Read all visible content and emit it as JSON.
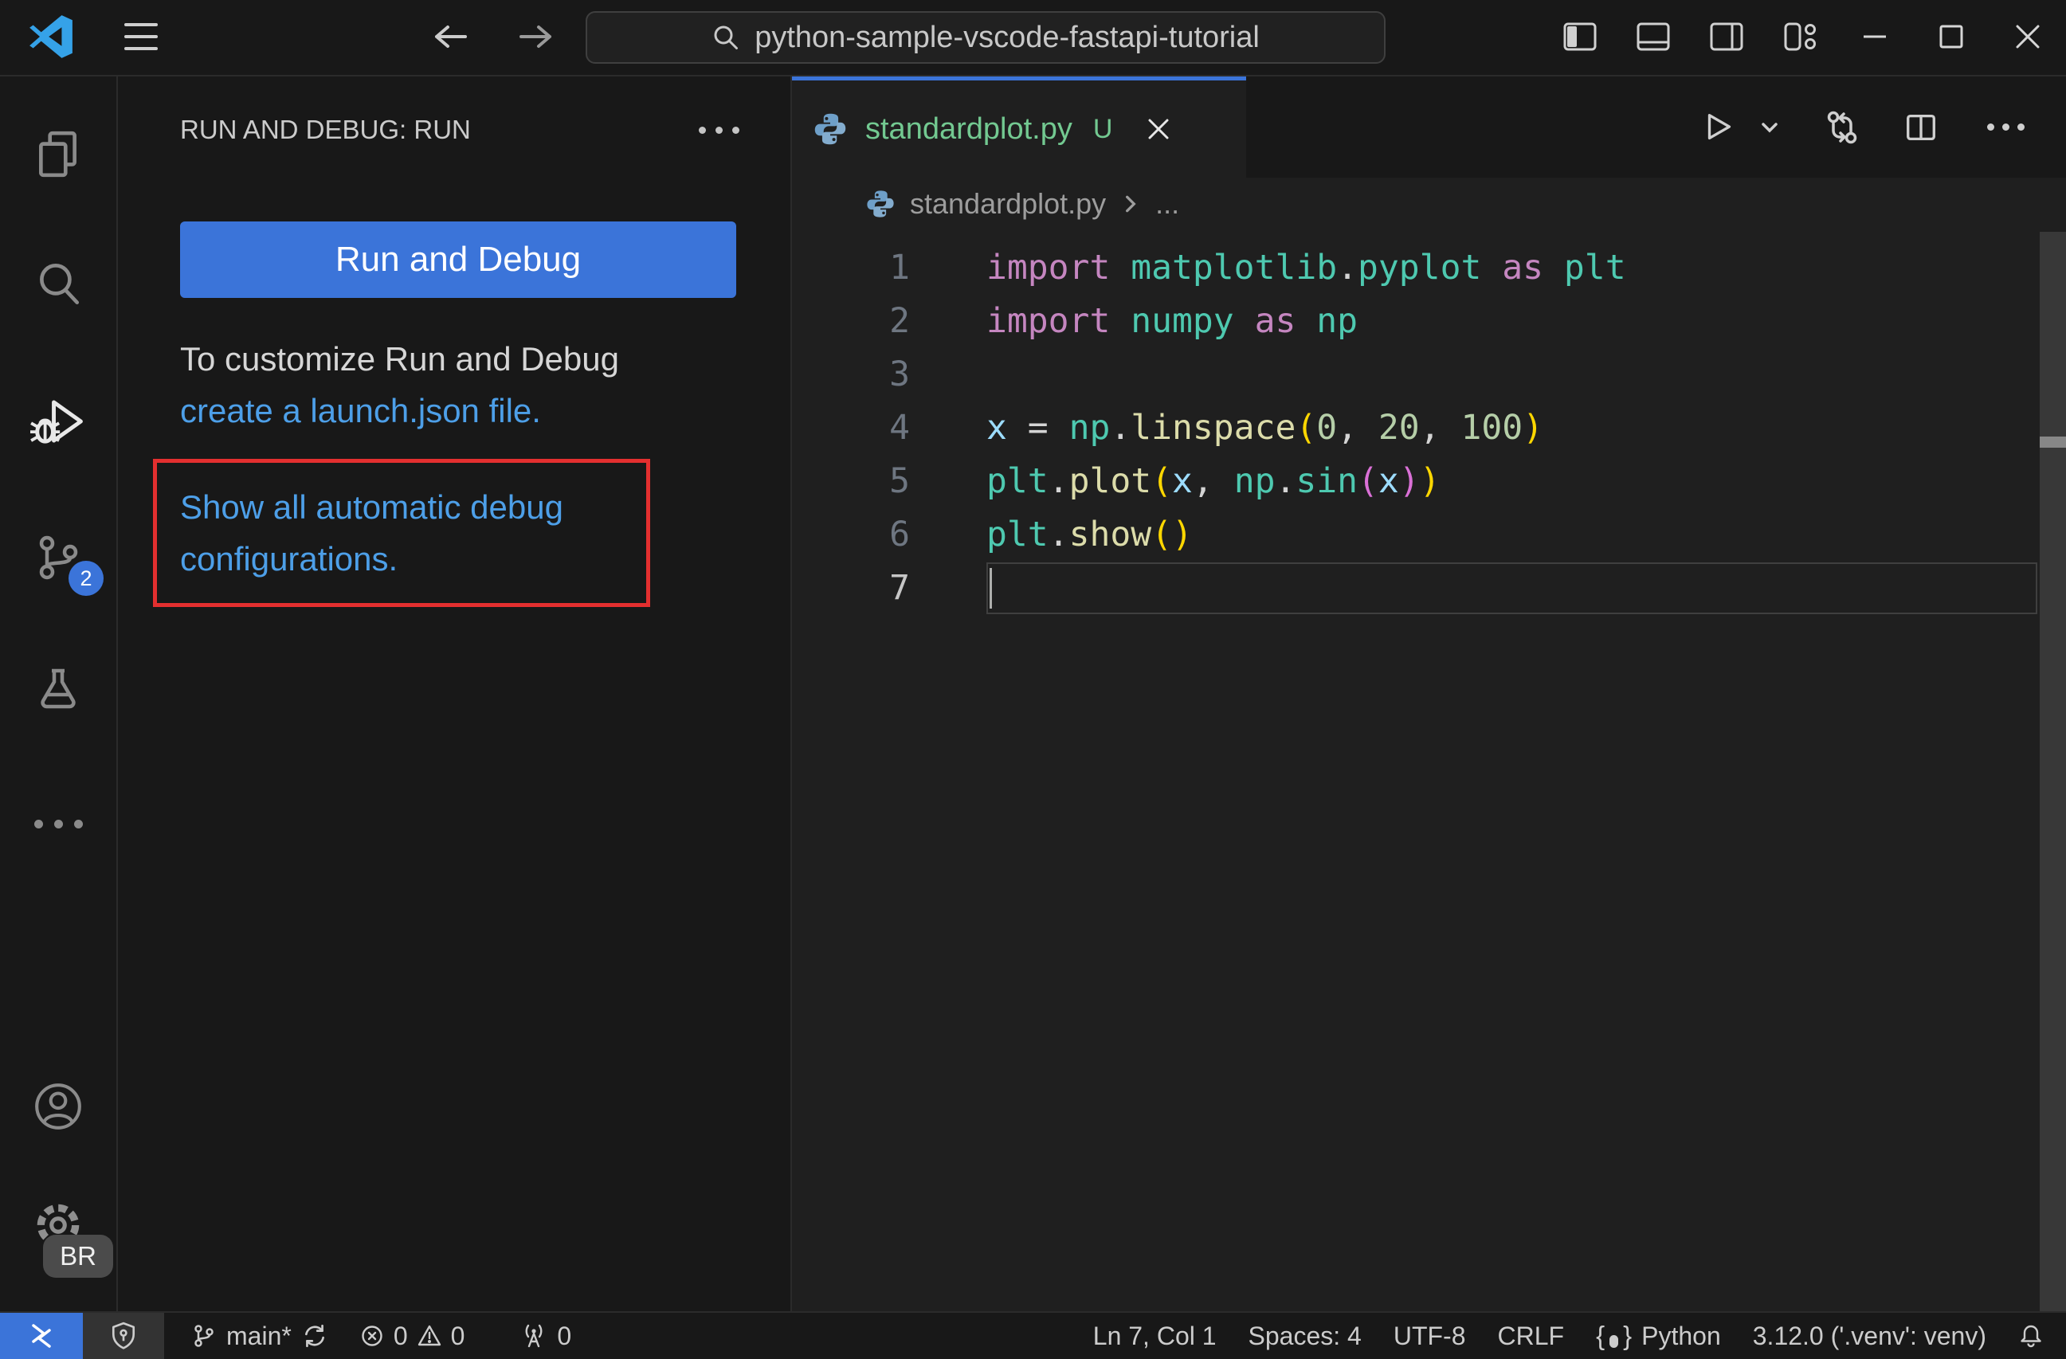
{
  "colors": {
    "accent_blue": "#3B74D9",
    "link_blue": "#4D9FE8",
    "annotation_red": "#E32F2F",
    "git_untracked_green": "#73C991",
    "editor_background": "#1F1F1F",
    "chrome_background": "#181818"
  },
  "title_bar": {
    "search_value": "python-sample-vscode-fastapi-tutorial"
  },
  "activity_bar": {
    "source_control_badge": "2",
    "settings_badge": "BR"
  },
  "sidebar": {
    "header": "RUN AND DEBUG: RUN",
    "run_button_label": "Run and Debug",
    "welcome_line1": "To customize Run and Debug",
    "welcome_link": "create a launch.json file.",
    "show_all_link_line1": "Show all automatic debug",
    "show_all_link_line2": "configurations."
  },
  "editor": {
    "tab": {
      "label": "standardplot.py",
      "modified_badge": "U"
    },
    "breadcrumb": {
      "file": "standardplot.py",
      "ellipsis": "..."
    },
    "code": {
      "lines": [
        {
          "num": "1",
          "current": false,
          "tokens": [
            {
              "t": "import",
              "c": "kw"
            },
            {
              "t": " ",
              "c": "pn"
            },
            {
              "t": "matplotlib",
              "c": "ns"
            },
            {
              "t": ".",
              "c": "pn"
            },
            {
              "t": "pyplot",
              "c": "ns"
            },
            {
              "t": " ",
              "c": "pn"
            },
            {
              "t": "as",
              "c": "kw"
            },
            {
              "t": " ",
              "c": "pn"
            },
            {
              "t": "plt",
              "c": "ns"
            }
          ]
        },
        {
          "num": "2",
          "current": false,
          "tokens": [
            {
              "t": "import",
              "c": "kw"
            },
            {
              "t": " ",
              "c": "pn"
            },
            {
              "t": "numpy",
              "c": "ns"
            },
            {
              "t": " ",
              "c": "pn"
            },
            {
              "t": "as",
              "c": "kw"
            },
            {
              "t": " ",
              "c": "pn"
            },
            {
              "t": "np",
              "c": "ns"
            }
          ]
        },
        {
          "num": "3",
          "current": false,
          "tokens": []
        },
        {
          "num": "4",
          "current": false,
          "tokens": [
            {
              "t": "x",
              "c": "var"
            },
            {
              "t": " ",
              "c": "pn"
            },
            {
              "t": "=",
              "c": "pn"
            },
            {
              "t": " ",
              "c": "pn"
            },
            {
              "t": "np",
              "c": "ns"
            },
            {
              "t": ".",
              "c": "pn"
            },
            {
              "t": "linspace",
              "c": "fn"
            },
            {
              "t": "(",
              "c": "b1"
            },
            {
              "t": "0",
              "c": "num"
            },
            {
              "t": ", ",
              "c": "pn"
            },
            {
              "t": "20",
              "c": "num"
            },
            {
              "t": ", ",
              "c": "pn"
            },
            {
              "t": "100",
              "c": "num"
            },
            {
              "t": ")",
              "c": "b1"
            }
          ]
        },
        {
          "num": "5",
          "current": false,
          "tokens": [
            {
              "t": "plt",
              "c": "ns"
            },
            {
              "t": ".",
              "c": "pn"
            },
            {
              "t": "plot",
              "c": "fn"
            },
            {
              "t": "(",
              "c": "b1"
            },
            {
              "t": "x",
              "c": "var"
            },
            {
              "t": ", ",
              "c": "pn"
            },
            {
              "t": "np",
              "c": "ns"
            },
            {
              "t": ".",
              "c": "pn"
            },
            {
              "t": "sin",
              "c": "ns"
            },
            {
              "t": "(",
              "c": "b2"
            },
            {
              "t": "x",
              "c": "var"
            },
            {
              "t": ")",
              "c": "b2"
            },
            {
              "t": ")",
              "c": "b1"
            }
          ]
        },
        {
          "num": "6",
          "current": false,
          "tokens": [
            {
              "t": "plt",
              "c": "ns"
            },
            {
              "t": ".",
              "c": "pn"
            },
            {
              "t": "show",
              "c": "fn"
            },
            {
              "t": "(",
              "c": "b1"
            },
            {
              "t": ")",
              "c": "b1"
            }
          ]
        },
        {
          "num": "7",
          "current": true,
          "tokens": []
        }
      ]
    }
  },
  "status_bar": {
    "branch": "main*",
    "errors": "0",
    "warnings": "0",
    "ports": "0",
    "line_col": "Ln 7, Col 1",
    "indent": "Spaces: 4",
    "encoding": "UTF-8",
    "eol": "CRLF",
    "language": "Python",
    "interpreter": "3.12.0 ('.venv': venv)"
  },
  "icons": {
    "vscode-logo": "vscode mark",
    "menu-icon": "hamburger",
    "arrow-left-icon": "back",
    "arrow-right-icon": "forward",
    "search-icon": "magnifier",
    "layout-sidebar-left-icon": "toggle primary sidebar",
    "layout-panel-icon": "toggle panel",
    "layout-sidebar-right-icon": "toggle secondary sidebar",
    "layout-customize-icon": "customize layout",
    "minimize-icon": "window minimize",
    "maximize-icon": "window maximize",
    "close-icon": "window close",
    "files-icon": "explorer",
    "debug-icon": "run and debug",
    "source-control-icon": "git branch",
    "testing-icon": "beaker",
    "more-icon": "ellipsis",
    "account-icon": "person",
    "gear-icon": "settings",
    "python-icon": "python logo",
    "run-icon": "play",
    "chevron-down-icon": "dropdown",
    "compare-changes-icon": "sync circles",
    "split-editor-icon": "split",
    "remote-icon": "><",
    "shield-icon": "workspace trust",
    "branch-icon": "git branch",
    "sync-icon": "refresh",
    "error-icon": "circle x",
    "warning-icon": "triangle !",
    "radio-tower-icon": "ports",
    "braces-icon": "language mode",
    "bell-icon": "notifications"
  }
}
